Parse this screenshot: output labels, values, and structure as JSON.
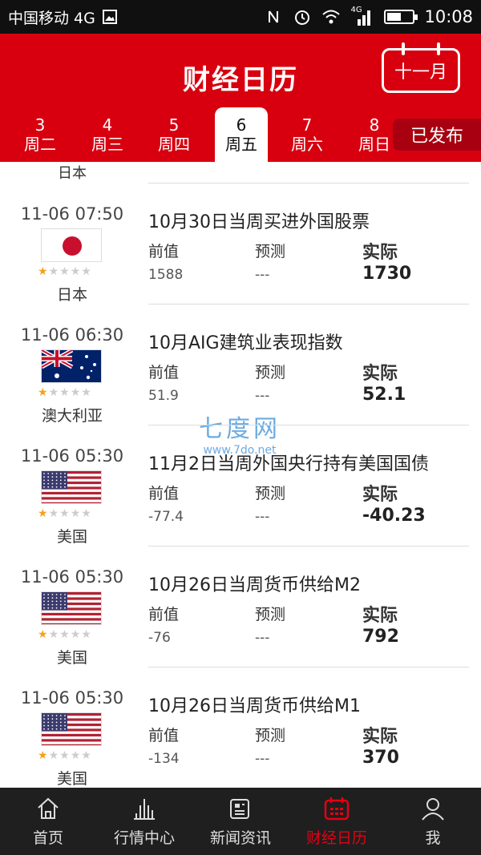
{
  "status": {
    "carrier": "中国移动 4G",
    "network_badge": "4G",
    "time": "10:08",
    "battery_level": 0.55,
    "icons": [
      "image-icon",
      "nfc-icon",
      "alarm-icon",
      "wifi-icon",
      "signal-icon",
      "battery-icon"
    ]
  },
  "header": {
    "title": "财经日历",
    "month_button": "十一月",
    "published_label": "已发布",
    "accent_color": "#d8000f"
  },
  "days": [
    {
      "num": "3",
      "weekday": "周二",
      "active": false
    },
    {
      "num": "4",
      "weekday": "周三",
      "active": false
    },
    {
      "num": "5",
      "weekday": "周四",
      "active": false
    },
    {
      "num": "6",
      "weekday": "周五",
      "active": true
    },
    {
      "num": "7",
      "weekday": "周六",
      "active": false
    },
    {
      "num": "8",
      "weekday": "周日",
      "active": false
    }
  ],
  "partial_country": "日本",
  "labels": {
    "prev": "前值",
    "forecast": "预测",
    "actual": "实际"
  },
  "events": [
    {
      "time": "11-06 07:50",
      "title": "10月30日当周买进外国股票",
      "country": "日本",
      "flag": "japan",
      "prev": "1588",
      "forecast": "---",
      "actual": "1730",
      "stars": 1
    },
    {
      "time": "11-06 06:30",
      "title": "10月AIG建筑业表现指数",
      "country": "澳大利亚",
      "flag": "australia",
      "prev": "51.9",
      "forecast": "---",
      "actual": "52.1",
      "stars": 1
    },
    {
      "time": "11-06 05:30",
      "title": "11月2日当周外国央行持有美国国债",
      "country": "美国",
      "flag": "usa",
      "prev": "-77.4",
      "forecast": "---",
      "actual": "-40.23",
      "stars": 1
    },
    {
      "time": "11-06 05:30",
      "title": "10月26日当周货币供给M2",
      "country": "美国",
      "flag": "usa",
      "prev": "-76",
      "forecast": "---",
      "actual": "792",
      "stars": 1
    },
    {
      "time": "11-06 05:30",
      "title": "10月26日当周货币供给M1",
      "country": "美国",
      "flag": "usa",
      "prev": "-134",
      "forecast": "---",
      "actual": "370",
      "stars": 1
    }
  ],
  "watermark": {
    "title": "七度网",
    "url": "www.7do.net"
  },
  "nav": [
    {
      "label": "首页",
      "icon": "home-icon",
      "active": false
    },
    {
      "label": "行情中心",
      "icon": "chart-icon",
      "active": false
    },
    {
      "label": "新闻资讯",
      "icon": "news-icon",
      "active": false
    },
    {
      "label": "财经日历",
      "icon": "calendar-icon",
      "active": true
    },
    {
      "label": "我",
      "icon": "user-icon",
      "active": false
    }
  ]
}
